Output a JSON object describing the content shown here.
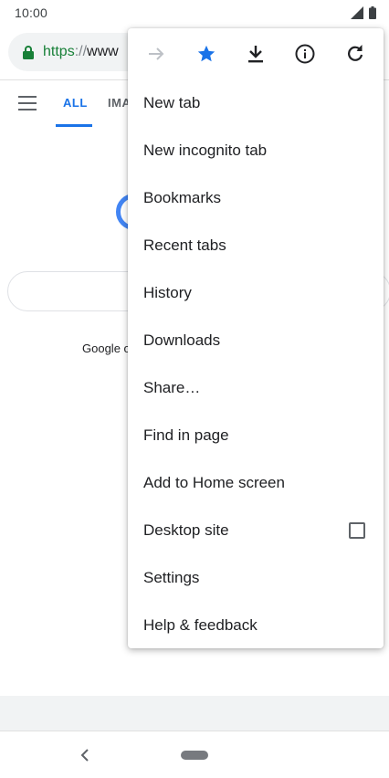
{
  "status_bar": {
    "time": "10:00"
  },
  "url_bar": {
    "scheme": "https",
    "separator": "://",
    "host": "www"
  },
  "google_page": {
    "tabs": [
      "ALL",
      "IMA"
    ],
    "offered_text": "Google o"
  },
  "menu": {
    "icons": [
      "forward-arrow-icon",
      "star-icon",
      "download-icon",
      "info-icon",
      "refresh-icon"
    ],
    "items": [
      {
        "label": "New tab"
      },
      {
        "label": "New incognito tab"
      },
      {
        "label": "Bookmarks"
      },
      {
        "label": "Recent tabs"
      },
      {
        "label": "History"
      },
      {
        "label": "Downloads"
      },
      {
        "label": "Share…"
      },
      {
        "label": "Find in page"
      },
      {
        "label": "Add to Home screen"
      },
      {
        "label": "Desktop site",
        "checked": false
      },
      {
        "label": "Settings"
      },
      {
        "label": "Help & feedback"
      }
    ]
  },
  "colors": {
    "accent_blue": "#1a73e8",
    "star_blue": "#1a73e8",
    "secure_green": "#188038",
    "icon_gray": "#5f6368"
  }
}
